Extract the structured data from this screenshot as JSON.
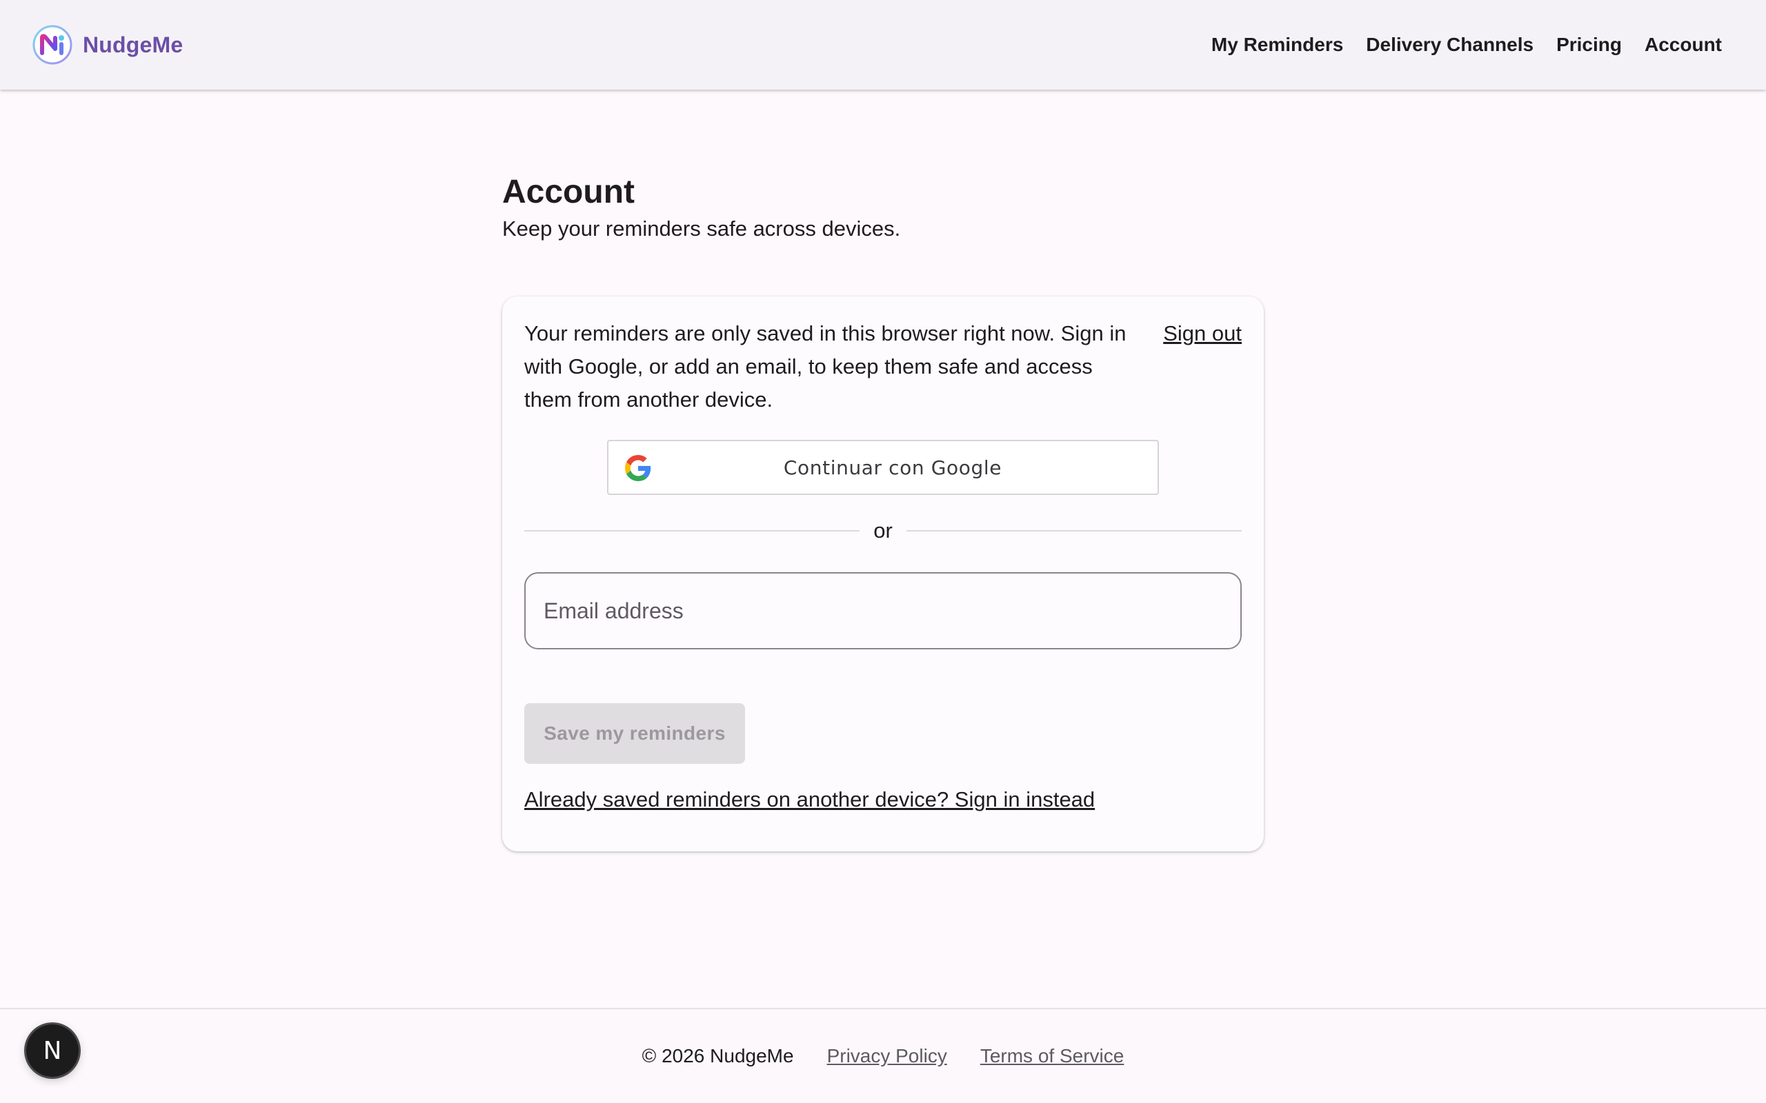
{
  "app": {
    "name": "NudgeMe",
    "brand_color": "#6b4fa6"
  },
  "header": {
    "nav": [
      {
        "label": "My Reminders"
      },
      {
        "label": "Delivery Channels"
      },
      {
        "label": "Pricing"
      },
      {
        "label": "Account"
      }
    ]
  },
  "main": {
    "title": "Account",
    "subtitle": "Keep your reminders safe across devices."
  },
  "card": {
    "intro": "Your reminders are only saved in this browser right now. Sign in with Google, or add an email, to keep them safe and access them from another device.",
    "sign_out_label": "Sign out",
    "google_button_label": "Continuar con Google",
    "google_icon": "google-g-icon",
    "divider_text": "or",
    "email_placeholder": "Email address",
    "email_value": "",
    "save_button_label": "Save my reminders",
    "save_button_disabled": true,
    "sign_in_link": "Already saved reminders on another device? Sign in instead"
  },
  "footer": {
    "copyright": "© 2026 NudgeMe",
    "links": [
      {
        "label": "Privacy Policy"
      },
      {
        "label": "Terms of Service"
      }
    ]
  },
  "devtools": {
    "letter": "N",
    "icon": "nextjs-devtools-icon"
  }
}
